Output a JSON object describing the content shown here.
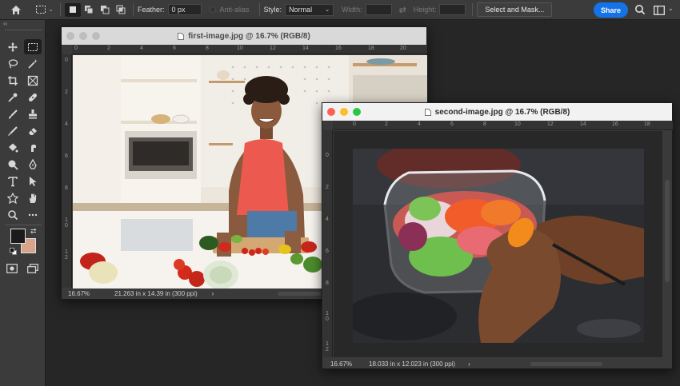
{
  "options_bar": {
    "feather_label": "Feather:",
    "feather_value": "0 px",
    "anti_alias_label": "Anti-alias",
    "style_label": "Style:",
    "style_value": "Normal",
    "width_label": "Width:",
    "height_label": "Height:",
    "select_mask_label": "Select and Mask...",
    "share_label": "Share"
  },
  "toolbar": {
    "collapse_glyph": "‹‹",
    "tools": [
      "move-icon",
      "marquee-icon",
      "lasso-icon",
      "magic-wand-icon",
      "crop-icon",
      "frame-icon",
      "eyedropper-icon",
      "spot-healing-icon",
      "brush-icon",
      "clone-stamp-icon",
      "history-brush-icon",
      "eraser-icon",
      "paint-bucket-icon",
      "smudge-icon",
      "dodge-icon",
      "pen-icon",
      "type-icon",
      "path-selection-icon",
      "shape-icon",
      "hand-icon",
      "zoom-icon",
      "more-icon"
    ],
    "foreground_color": "#1b1b1b",
    "background_color": "#d7a48b"
  },
  "doc1": {
    "title": "first-image.jpg @ 16.7% (RGB/8)",
    "zoom": "16.67%",
    "size_info": "21.263 in x 14.39 in (300 ppi)",
    "ruler_h": [
      "0",
      "2",
      "4",
      "6",
      "8",
      "10",
      "12",
      "14",
      "16",
      "18",
      "20"
    ],
    "ruler_v": [
      "0",
      "2",
      "4",
      "6",
      "8",
      "1 0",
      "1 2"
    ],
    "arrow": "›"
  },
  "doc2": {
    "title": "second-image.jpg @ 16.7% (RGB/8)",
    "zoom": "16.67%",
    "size_info": "18.033 in x 12.023 in (300 ppi)",
    "ruler_h": [
      "0",
      "2",
      "4",
      "6",
      "8",
      "10",
      "12",
      "14",
      "16",
      "18"
    ],
    "ruler_v": [
      "0",
      "2",
      "4",
      "6",
      "8",
      "1 0",
      "1 2"
    ],
    "arrow": "›"
  },
  "colors": {
    "accent": "#1473e6",
    "mac_close": "#fe5f57",
    "mac_min": "#febc2e",
    "mac_max": "#28c840"
  }
}
